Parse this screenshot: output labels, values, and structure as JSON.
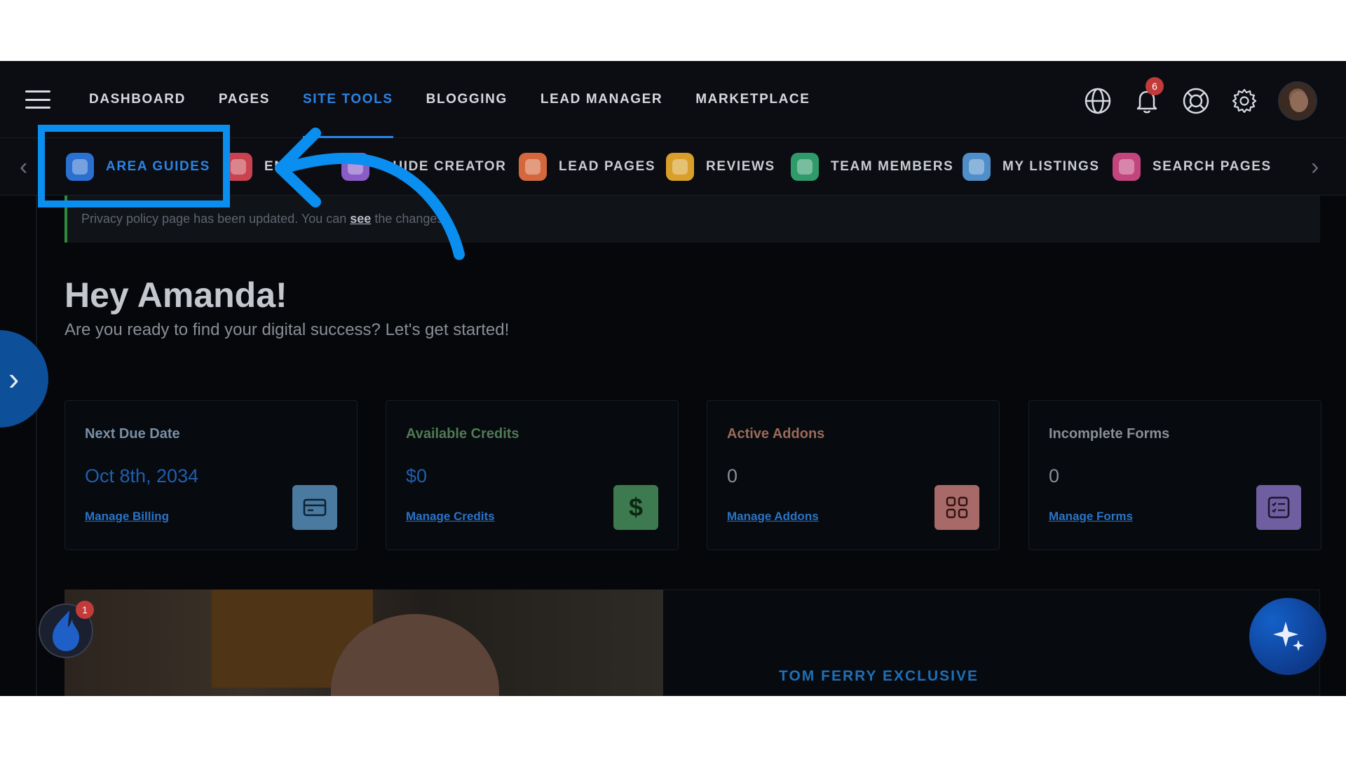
{
  "nav": {
    "items": [
      {
        "label": "DASHBOARD",
        "active": false
      },
      {
        "label": "PAGES",
        "active": false
      },
      {
        "label": "SITE TOOLS",
        "active": true
      },
      {
        "label": "BLOGGING",
        "active": false
      },
      {
        "label": "LEAD MANAGER",
        "active": false
      },
      {
        "label": "MARKETPLACE",
        "active": false
      }
    ],
    "notification_count": "6"
  },
  "subnav": {
    "items": [
      {
        "label": "AREA GUIDES",
        "active": true,
        "icon": "area-guides-icon",
        "color": "#2b6fd1"
      },
      {
        "label": "EN",
        "active": false,
        "icon": "ebook-icon",
        "color": "#c8424f"
      },
      {
        "label": "GUIDE CREATOR",
        "active": false,
        "icon": "guide-creator-icon",
        "color": "#8a5dc6"
      },
      {
        "label": "LEAD PAGES",
        "active": false,
        "icon": "lead-pages-icon",
        "color": "#d4683c"
      },
      {
        "label": "REVIEWS",
        "active": false,
        "icon": "reviews-icon",
        "color": "#d8a02a"
      },
      {
        "label": "TEAM MEMBERS",
        "active": false,
        "icon": "team-members-icon",
        "color": "#2f9a6a"
      },
      {
        "label": "MY LISTINGS",
        "active": false,
        "icon": "my-listings-icon",
        "color": "#4f8ec8"
      },
      {
        "label": "SEARCH PAGES",
        "active": false,
        "icon": "search-pages-icon",
        "color": "#c2457e"
      }
    ]
  },
  "notice": {
    "before": "Privacy policy page has been updated. You can",
    "link": "see",
    "after": "the changes."
  },
  "greeting": {
    "title": "Hey Amanda!",
    "subtitle": "Are you ready to find your digital success? Let's get started!"
  },
  "cards": [
    {
      "title": "Next Due Date",
      "value": "Oct 8th, 2034",
      "link": "Manage Billing",
      "title_color": "#7a8fa8",
      "value_color": "#1f5fae",
      "icon": "credit-card-icon",
      "icon_bg": "#4a7aa0"
    },
    {
      "title": "Available Credits",
      "value": "$0",
      "link": "Manage Credits",
      "title_color": "#4f7a55",
      "value_color": "#1f5fae",
      "icon": "dollar-icon",
      "icon_bg": "#3d7a4f"
    },
    {
      "title": "Active Addons",
      "value": "0",
      "link": "Manage Addons",
      "title_color": "#9a6a5a",
      "value_color": "#8a8e96",
      "icon": "grid-icon",
      "icon_bg": "#a86a68"
    },
    {
      "title": "Incomplete Forms",
      "value": "0",
      "link": "Manage Forms",
      "title_color": "#8a8e96",
      "value_color": "#8a8e96",
      "icon": "form-list-icon",
      "icon_bg": "#6f5fa0"
    }
  ],
  "promo": {
    "title": "TOM FERRY EXCLUSIVE"
  },
  "chat_badge": "1"
}
